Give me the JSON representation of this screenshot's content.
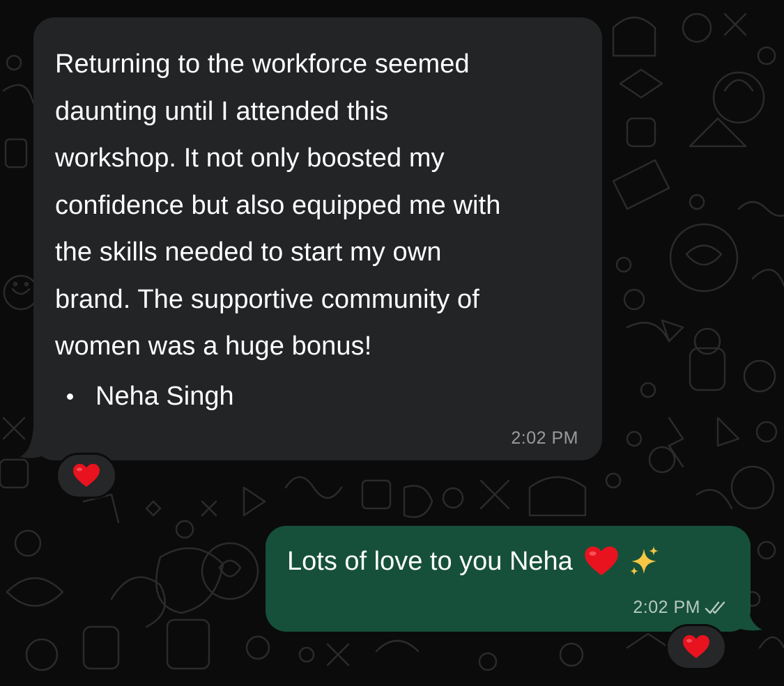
{
  "colors": {
    "background": "#0b0b0b",
    "incoming_bubble": "#232426",
    "outgoing_bubble": "#16503a",
    "text": "#ffffff",
    "timestamp_incoming": "#9b9b9b",
    "timestamp_outgoing": "#b7c9c0",
    "heart": "#e8131f"
  },
  "incoming_message": {
    "lines": [
      "Returning to the workforce seemed",
      "daunting until I attended this",
      "workshop. It not only boosted my",
      "confidence but also equipped me with",
      "the skills needed to start my own",
      "brand. The supportive community of",
      "women was a huge bonus!"
    ],
    "bullet_item": "Neha Singh",
    "time": "2:02 PM",
    "reaction_icon": "red-heart-emoji"
  },
  "outgoing_message": {
    "text": "Lots of love to you Neha",
    "emojis": [
      "red-heart-emoji",
      "sparkles-emoji"
    ],
    "time": "2:02 PM",
    "status_icon": "double-check-icon",
    "reaction_icon": "red-heart-emoji"
  }
}
